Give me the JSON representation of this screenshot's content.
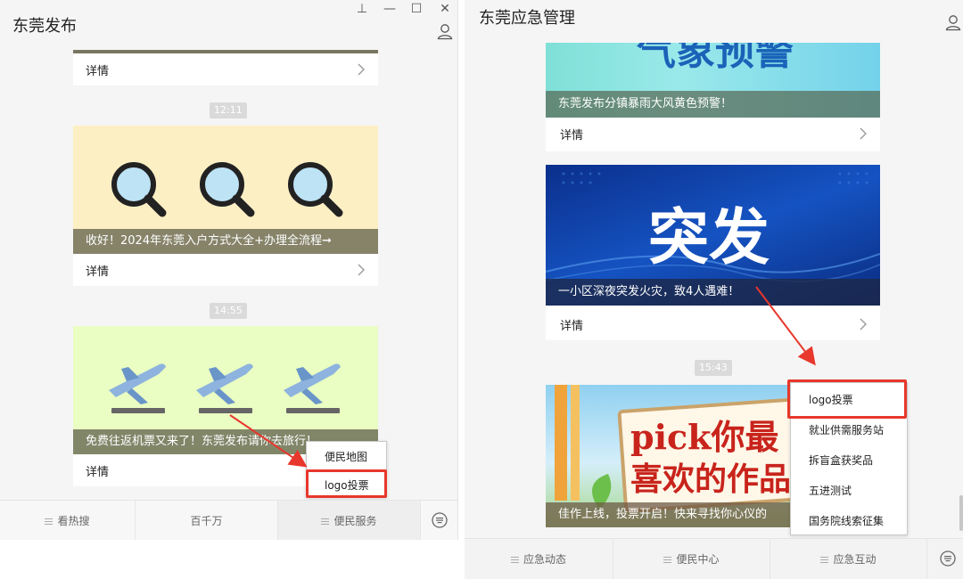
{
  "left": {
    "title": "东莞发布",
    "window_controls": {
      "pin": "⊥",
      "minimize": "—",
      "maximize": "☐",
      "close": "✕"
    },
    "top_card": {
      "detail": "详情"
    },
    "timestamps": [
      "12:11",
      "14:55"
    ],
    "cards": [
      {
        "caption": "收好！2024年东莞入户方式大全+办理全流程➞",
        "detail": "详情",
        "image_icon": "magnifier-icon"
      },
      {
        "caption": "免费往返机票又来了！东莞发布请你去旅行！",
        "detail": "详情",
        "image_icon": "airplane-icon"
      }
    ],
    "popup": {
      "items": [
        "便民地图",
        "logo投票"
      ],
      "highlighted": "logo投票"
    },
    "menu": [
      "看热搜",
      "百千万",
      "便民服务"
    ]
  },
  "right": {
    "title": "东莞应急管理",
    "cards": [
      {
        "banner": "气象预警",
        "caption": "东莞发布分镇暴雨大风黄色预警！",
        "detail": "详情"
      },
      {
        "banner": "突发",
        "caption": "一小区深夜突发火灾，致4人遇难！",
        "detail": "详情"
      },
      {
        "banner": "pick你最喜欢的作品",
        "banner_line1": "pick你最",
        "banner_line2": "喜欢的作品",
        "caption": "佳作上线，投票开启！快来寻找你心仪的"
      }
    ],
    "timestamp": "15:43",
    "popup": {
      "items": [
        "logo投票",
        "就业供需服务站",
        "拆盲盒获奖品",
        "五进测试",
        "国务院线索征集"
      ],
      "highlighted": "logo投票"
    },
    "menu": [
      "应急动态",
      "便民中心",
      "应急互动"
    ]
  },
  "colors": {
    "highlight": "#e8372c",
    "caption_overlay": "#646450"
  }
}
